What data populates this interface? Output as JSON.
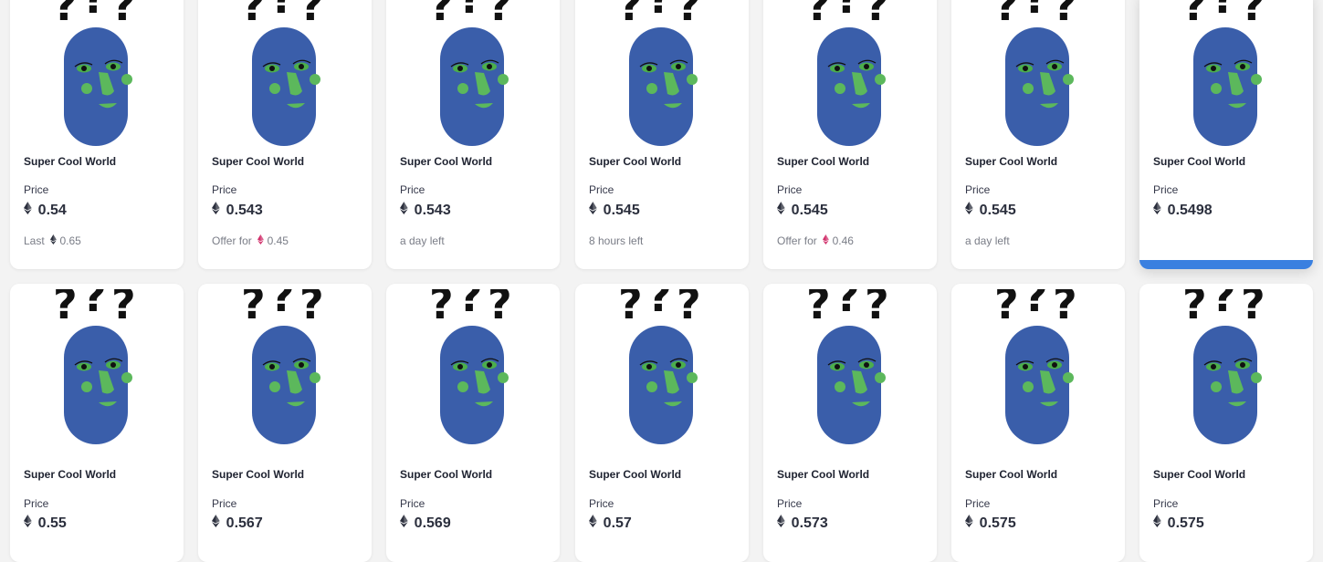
{
  "colors": {
    "head": "#3a5eaa",
    "face": "#5cb85c",
    "eye_white": "#4cae4c",
    "accent": "#3a80e0",
    "offer_eth": "#d1306b"
  },
  "cards": [
    {
      "name": "Super Cool World",
      "price_label": "Price",
      "price": "0.54",
      "footer_text": "Last",
      "footer_value": "0.65",
      "footer_icon": "eth-black"
    },
    {
      "name": "Super Cool World",
      "price_label": "Price",
      "price": "0.543",
      "footer_text": "Offer for",
      "footer_value": "0.45",
      "footer_icon": "eth-pink"
    },
    {
      "name": "Super Cool World",
      "price_label": "Price",
      "price": "0.543",
      "footer_text": "a day left",
      "footer_value": "",
      "footer_icon": ""
    },
    {
      "name": "Super Cool World",
      "price_label": "Price",
      "price": "0.545",
      "footer_text": "8 hours left",
      "footer_value": "",
      "footer_icon": ""
    },
    {
      "name": "Super Cool World",
      "price_label": "Price",
      "price": "0.545",
      "footer_text": "Offer for",
      "footer_value": "0.46",
      "footer_icon": "eth-pink"
    },
    {
      "name": "Super Cool World",
      "price_label": "Price",
      "price": "0.545",
      "footer_text": "a day left",
      "footer_value": "",
      "footer_icon": ""
    },
    {
      "name": "Super Cool World",
      "price_label": "Price",
      "price": "0.5498",
      "footer_text": "",
      "footer_value": "",
      "footer_icon": "",
      "hovered": true
    },
    {
      "name": "Super Cool World",
      "price_label": "Price",
      "price": "0.55"
    },
    {
      "name": "Super Cool World",
      "price_label": "Price",
      "price": "0.567"
    },
    {
      "name": "Super Cool World",
      "price_label": "Price",
      "price": "0.569"
    },
    {
      "name": "Super Cool World",
      "price_label": "Price",
      "price": "0.57"
    },
    {
      "name": "Super Cool World",
      "price_label": "Price",
      "price": "0.573"
    },
    {
      "name": "Super Cool World",
      "price_label": "Price",
      "price": "0.575"
    },
    {
      "name": "Super Cool World",
      "price_label": "Price",
      "price": "0.575"
    }
  ]
}
